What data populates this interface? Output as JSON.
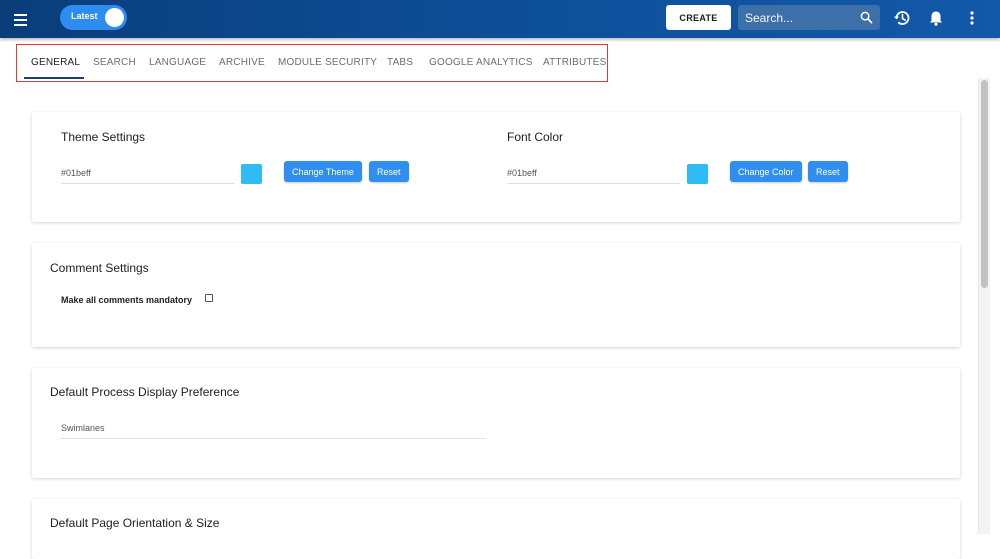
{
  "appbar": {
    "menu_icon": "hamburger-menu-icon",
    "toggle_label": "Latest",
    "create_label": "CREATE",
    "search_placeholder": "Search...",
    "accent": "#0e4e98"
  },
  "tabs": [
    {
      "label": "GENERAL",
      "active": true
    },
    {
      "label": "SEARCH"
    },
    {
      "label": "LANGUAGE"
    },
    {
      "label": "ARCHIVE"
    },
    {
      "label": "MODULE SECURITY"
    },
    {
      "label": "TABS"
    },
    {
      "label": "GOOGLE ANALYTICS"
    },
    {
      "label": "ATTRIBUTES"
    }
  ],
  "theme_settings": {
    "title": "Theme Settings",
    "value": "#01beff",
    "change_label": "Change Theme",
    "reset_label": "Reset"
  },
  "font_color": {
    "title": "Font Color",
    "value": "#01beff",
    "change_label": "Change Color",
    "reset_label": "Reset"
  },
  "comment_settings": {
    "title": "Comment Settings",
    "checkbox_label": "Make all comments mandatory",
    "checked": false
  },
  "process_display": {
    "title": "Default Process Display Preference",
    "value": "Swimlanes"
  },
  "page_orientation": {
    "title": "Default Page Orientation & Size"
  },
  "colors": {
    "swatch": "#2fbcf5",
    "button": "#2f8ef0"
  }
}
